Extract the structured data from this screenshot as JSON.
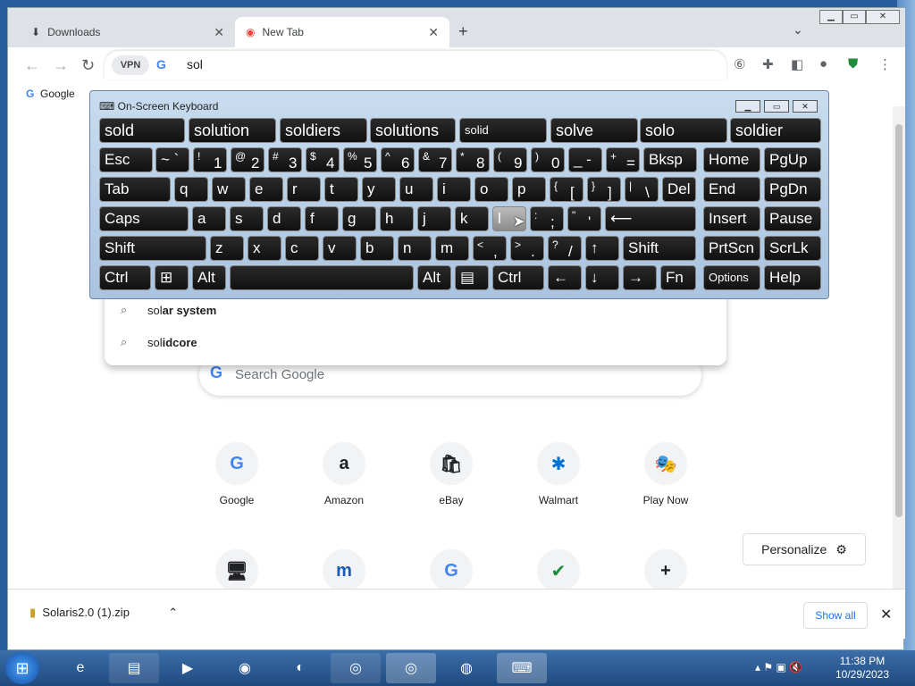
{
  "browser": {
    "tabs": [
      {
        "title": "Downloads",
        "icon": "download-icon"
      },
      {
        "title": "New Tab",
        "icon": "chrome-icon"
      }
    ],
    "new_tab": "+",
    "omnibox": {
      "vpn_label": "VPN",
      "text": "sol"
    },
    "bookmark": "Google"
  },
  "suggestions": [
    "solar system",
    "solidcore"
  ],
  "suggestion_parts": [
    {
      "prefix": "sol",
      "rest": "ar system"
    },
    {
      "prefix": "sol",
      "rest": "idcore"
    }
  ],
  "search": {
    "placeholder": "Search Google"
  },
  "shortcuts_row1": [
    "Google",
    "Amazon",
    "eBay",
    "Walmart",
    "Play Now"
  ],
  "shortcut_glyphs_row1": [
    "G",
    "a",
    "🛍",
    "✱",
    "🎭"
  ],
  "shortcut_glyphs_row2": [
    "🖥",
    "m",
    "G",
    "✔",
    "+"
  ],
  "personalize": "Personalize",
  "downloads_bar": {
    "file": "Solaris2.0 (1).zip",
    "show_all": "Show all"
  },
  "keyboard": {
    "title": "On-Screen Keyboard",
    "predictions": [
      "sold",
      "solution",
      "soldiers",
      "solutions",
      "solid",
      "solve",
      "solo",
      "soldier"
    ],
    "row1_labels": [
      "Esc",
      "Bksp",
      "Home",
      "PgUp"
    ],
    "row2_labels": [
      "Tab",
      "q",
      "w",
      "e",
      "r",
      "t",
      "y",
      "u",
      "i",
      "o",
      "p",
      "Del",
      "End",
      "PgDn"
    ],
    "row3_labels": [
      "Caps",
      "a",
      "s",
      "d",
      "f",
      "g",
      "h",
      "j",
      "k",
      "l",
      "Insert",
      "Pause"
    ],
    "row4_labels": [
      "Shift",
      "z",
      "x",
      "c",
      "v",
      "b",
      "n",
      "m",
      "Shift",
      "PrtScn",
      "ScrLk"
    ],
    "row5_labels": [
      "Ctrl",
      "Alt",
      "Alt",
      "Ctrl",
      "Fn",
      "Options",
      "Help"
    ]
  },
  "taskbar": {
    "time": "11:38 PM",
    "date": "10/29/2023"
  }
}
